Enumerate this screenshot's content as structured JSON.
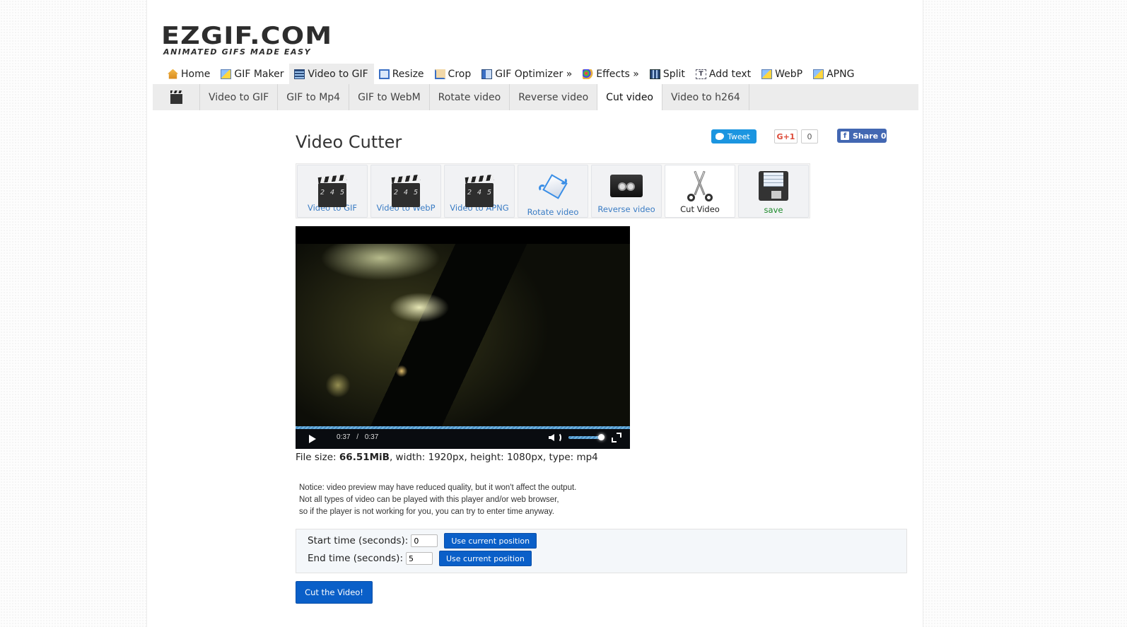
{
  "logo": {
    "title": "EZGIF.COM",
    "tagline": "ANIMATED GIFS MADE EASY"
  },
  "mainnav": [
    {
      "label": "Home",
      "icon": "home-icon"
    },
    {
      "label": "GIF Maker",
      "icon": "image-icon"
    },
    {
      "label": "Video to GIF",
      "icon": "film-icon",
      "active": true
    },
    {
      "label": "Resize",
      "icon": "resize-icon"
    },
    {
      "label": "Crop",
      "icon": "crop-icon"
    },
    {
      "label": "GIF Optimizer »",
      "icon": "optimizer-icon"
    },
    {
      "label": "Effects »",
      "icon": "palette-icon"
    },
    {
      "label": "Split",
      "icon": "split-icon"
    },
    {
      "label": "Add text",
      "icon": "text-icon"
    },
    {
      "label": "WebP",
      "icon": "image-icon"
    },
    {
      "label": "APNG",
      "icon": "image-icon"
    }
  ],
  "subnav": [
    {
      "label": "Video to GIF"
    },
    {
      "label": "GIF to Mp4"
    },
    {
      "label": "GIF to WebM"
    },
    {
      "label": "Rotate video"
    },
    {
      "label": "Reverse video"
    },
    {
      "label": "Cut video",
      "active": true
    },
    {
      "label": "Video to h264"
    }
  ],
  "page": {
    "title": "Video Cutter"
  },
  "share": {
    "tweet": "Tweet",
    "gplus": "G+1",
    "gplus_count": "0",
    "facebook": "Share 0"
  },
  "tools": [
    {
      "label": "Video to GIF",
      "icon": "clapperboard-icon"
    },
    {
      "label": "Video to WebP",
      "icon": "clapperboard-icon"
    },
    {
      "label": "Video to APNG",
      "icon": "clapperboard-icon"
    },
    {
      "label": "Rotate video",
      "icon": "rotate-icon"
    },
    {
      "label": "Reverse video",
      "icon": "cassette-icon"
    },
    {
      "label": "Cut Video",
      "icon": "scissors-icon",
      "active": true
    },
    {
      "label": "save",
      "icon": "floppy-disk-icon"
    }
  ],
  "player": {
    "current_time": "0:37",
    "separator": "/",
    "duration": "0:37",
    "progress": 1.0,
    "volume": 0.9
  },
  "fileinfo": {
    "prefix": "File size: ",
    "size": "66.51MiB",
    "rest": ", width: 1920px, height: 1080px, type: mp4"
  },
  "notice": {
    "line1": "Notice: video preview may have reduced quality, but it won't affect the output.",
    "line2": "Not all types of video can be played with this player and/or web browser,",
    "line3": "so if the player is not working for you, you can try to enter time anyway."
  },
  "form": {
    "start_label": "Start time (seconds):",
    "start_value": "0",
    "end_label": "End time (seconds):",
    "end_value": "5",
    "use_position": "Use current position",
    "submit": "Cut the Video!"
  }
}
